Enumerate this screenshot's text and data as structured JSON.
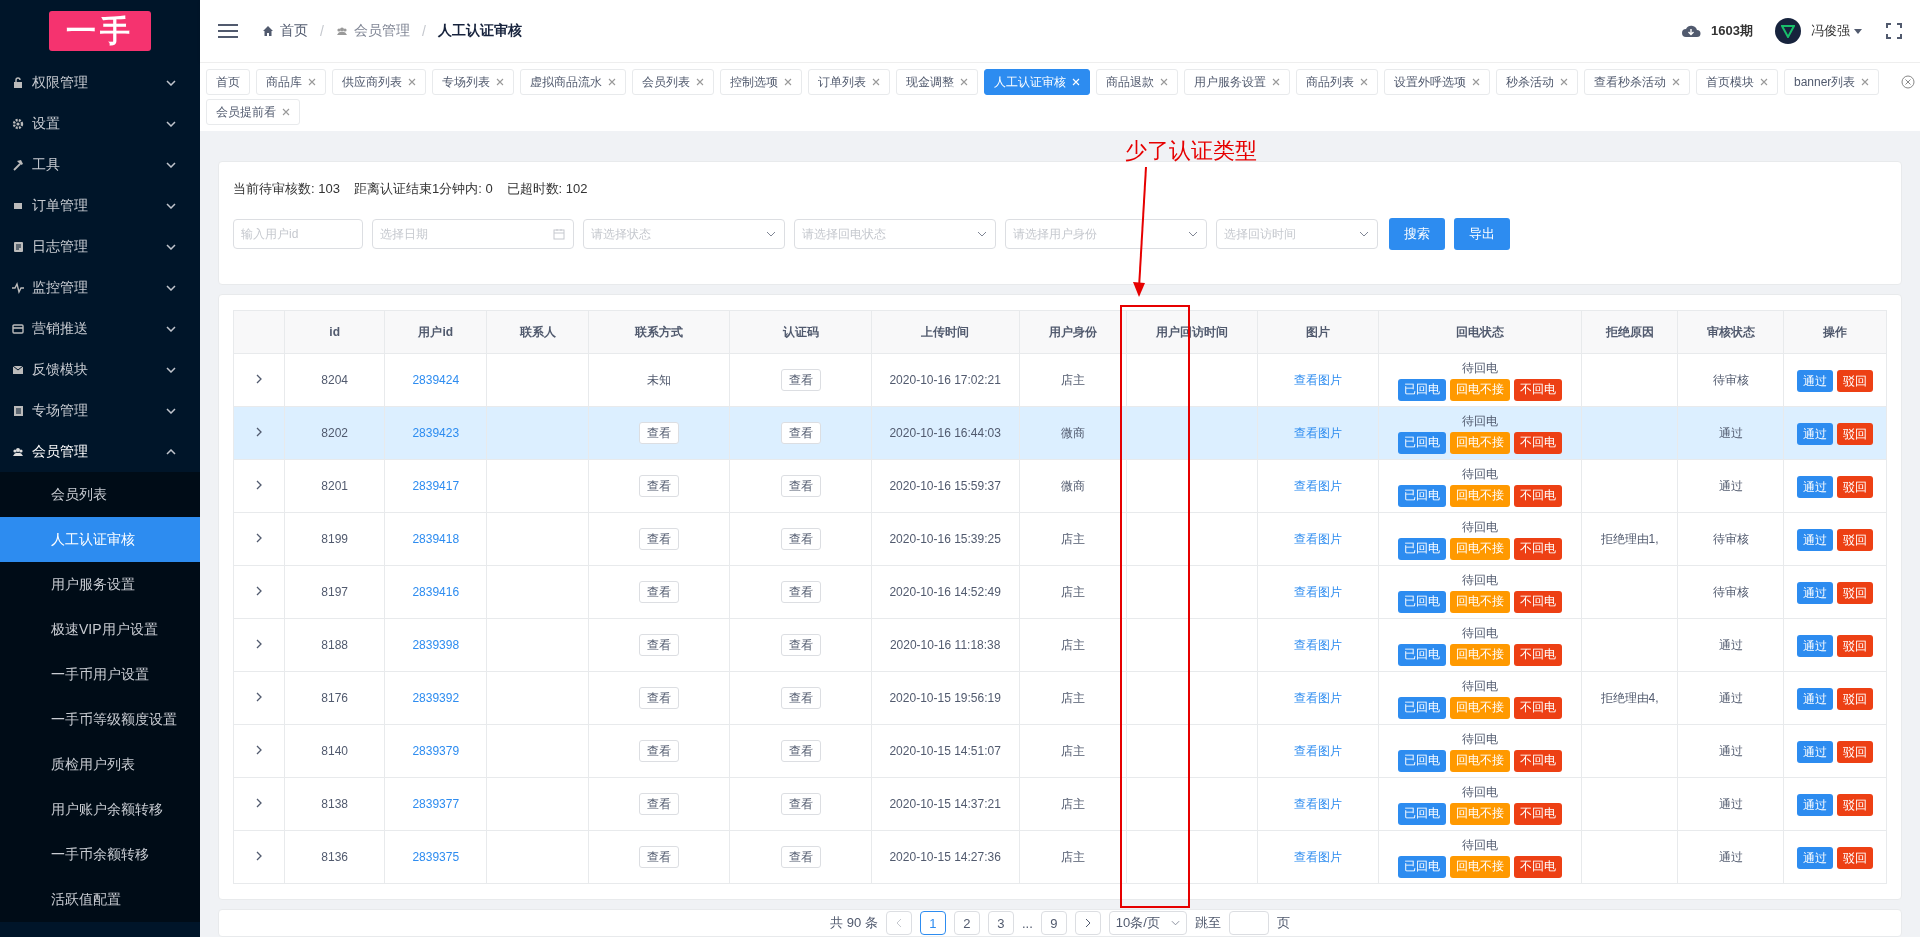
{
  "logo": {
    "text": "一手"
  },
  "sidebar": {
    "items": [
      {
        "label": "权限管理",
        "expanded": false
      },
      {
        "label": "设置",
        "expanded": false
      },
      {
        "label": "工具",
        "expanded": false
      },
      {
        "label": "订单管理",
        "expanded": false
      },
      {
        "label": "日志管理",
        "expanded": false
      },
      {
        "label": "监控管理",
        "expanded": false
      },
      {
        "label": "营销推送",
        "expanded": false
      },
      {
        "label": "反馈模块",
        "expanded": false
      },
      {
        "label": "专场管理",
        "expanded": false
      },
      {
        "label": "会员管理",
        "expanded": true,
        "children": [
          {
            "label": "会员列表",
            "selected": false
          },
          {
            "label": "人工认证审核",
            "selected": true
          },
          {
            "label": "用户服务设置",
            "selected": false
          },
          {
            "label": "极速VIP用户设置",
            "selected": false
          },
          {
            "label": "一手币用户设置",
            "selected": false
          },
          {
            "label": "一手币等级额度设置",
            "selected": false
          },
          {
            "label": "质检用户列表",
            "selected": false
          },
          {
            "label": "用户账户余额转移",
            "selected": false
          },
          {
            "label": "一手币余额转移",
            "selected": false
          },
          {
            "label": "活跃值配置",
            "selected": false
          }
        ]
      }
    ]
  },
  "breadcrumb_separator": "/",
  "breadcrumb": [
    {
      "label": "首页"
    },
    {
      "label": "会员管理"
    },
    {
      "label": "人工认证审核"
    }
  ],
  "header": {
    "period": "1603期",
    "user": "冯俊强"
  },
  "tabs": [
    {
      "label": "首页",
      "closable": false,
      "selected": false
    },
    {
      "label": "商品库",
      "closable": true,
      "selected": false
    },
    {
      "label": "供应商列表",
      "closable": true,
      "selected": false
    },
    {
      "label": "专场列表",
      "closable": true,
      "selected": false
    },
    {
      "label": "虚拟商品流水",
      "closable": true,
      "selected": false
    },
    {
      "label": "会员列表",
      "closable": true,
      "selected": false
    },
    {
      "label": "控制选项",
      "closable": true,
      "selected": false
    },
    {
      "label": "订单列表",
      "closable": true,
      "selected": false
    },
    {
      "label": "现金调整",
      "closable": true,
      "selected": false
    },
    {
      "label": "人工认证审核",
      "closable": true,
      "selected": true
    },
    {
      "label": "商品退款",
      "closable": true,
      "selected": false
    },
    {
      "label": "用户服务设置",
      "closable": true,
      "selected": false
    },
    {
      "label": "商品列表",
      "closable": true,
      "selected": false
    },
    {
      "label": "设置外呼选项",
      "closable": true,
      "selected": false
    },
    {
      "label": "秒杀活动",
      "closable": true,
      "selected": false
    },
    {
      "label": "查看秒杀活动",
      "closable": true,
      "selected": false
    },
    {
      "label": "首页模块",
      "closable": true,
      "selected": false
    },
    {
      "label": "banner列表",
      "closable": true,
      "selected": false
    },
    {
      "label": "会员提前看",
      "closable": true,
      "selected": false
    }
  ],
  "stats": [
    "当前待审核数: 103",
    "距离认证结束1分钟内: 0",
    "已超时数: 102"
  ],
  "filters": [
    {
      "kind": "input",
      "placeholder": "输入用户id"
    },
    {
      "kind": "date",
      "placeholder": "选择日期"
    },
    {
      "kind": "select",
      "placeholder": "请选择状态"
    },
    {
      "kind": "select",
      "placeholder": "请选择回电状态"
    },
    {
      "kind": "select",
      "placeholder": "请选择用户身份"
    },
    {
      "kind": "select",
      "placeholder": "选择回访时间"
    }
  ],
  "filter_buttons": [
    "搜索",
    "导出"
  ],
  "table": {
    "columns": [
      "id",
      "用户id",
      "联系人",
      "联系方式",
      "认证码",
      "上传时间",
      "用户身份",
      "用户回访时间",
      "图片",
      "回电状态",
      "拒绝原因",
      "审核状态",
      "操作"
    ],
    "rows": [
      {
        "id": "8204",
        "user_id": "2839424",
        "contact": {
          "kind": "text",
          "label": "未知"
        },
        "code": "查看",
        "upload_time": "2020-10-16 17:02:21",
        "identity": "店主",
        "image": "查看图片",
        "callback_status": "待回电",
        "callback_buttons": [
          {
            "label": "已回电",
            "kind": "primary"
          },
          {
            "label": "回电不接",
            "kind": "warning"
          },
          {
            "label": "不回电",
            "kind": "danger"
          }
        ],
        "review_status": "待审核",
        "actions": [
          {
            "label": "通过",
            "kind": "primary"
          },
          {
            "label": "驳回",
            "kind": "danger"
          }
        ],
        "selected": false
      },
      {
        "id": "8202",
        "user_id": "2839423",
        "contact": {
          "kind": "button",
          "label": "查看"
        },
        "code": "查看",
        "upload_time": "2020-10-16 16:44:03",
        "identity": "微商",
        "image": "查看图片",
        "callback_status": "待回电",
        "callback_buttons": [
          {
            "label": "已回电",
            "kind": "primary"
          },
          {
            "label": "回电不接",
            "kind": "warning"
          },
          {
            "label": "不回电",
            "kind": "danger"
          }
        ],
        "review_status": "通过",
        "actions": [
          {
            "label": "通过",
            "kind": "primary"
          },
          {
            "label": "驳回",
            "kind": "danger"
          }
        ],
        "selected": true
      },
      {
        "id": "8201",
        "user_id": "2839417",
        "contact": {
          "kind": "button",
          "label": "查看"
        },
        "code": "查看",
        "upload_time": "2020-10-16 15:59:37",
        "identity": "微商",
        "image": "查看图片",
        "callback_status": "待回电",
        "callback_buttons": [
          {
            "label": "已回电",
            "kind": "primary"
          },
          {
            "label": "回电不接",
            "kind": "warning"
          },
          {
            "label": "不回电",
            "kind": "danger"
          }
        ],
        "review_status": "通过",
        "actions": [
          {
            "label": "通过",
            "kind": "primary"
          },
          {
            "label": "驳回",
            "kind": "danger"
          }
        ],
        "selected": false
      },
      {
        "id": "8199",
        "user_id": "2839418",
        "contact": {
          "kind": "button",
          "label": "查看"
        },
        "code": "查看",
        "upload_time": "2020-10-16 15:39:25",
        "identity": "店主",
        "image": "查看图片",
        "callback_status": "待回电",
        "callback_buttons": [
          {
            "label": "已回电",
            "kind": "primary"
          },
          {
            "label": "回电不接",
            "kind": "warning"
          },
          {
            "label": "不回电",
            "kind": "danger"
          }
        ],
        "reject_reason": "拒绝理由1,",
        "review_status": "待审核",
        "actions": [
          {
            "label": "通过",
            "kind": "primary"
          },
          {
            "label": "驳回",
            "kind": "danger"
          }
        ],
        "selected": false
      },
      {
        "id": "8197",
        "user_id": "2839416",
        "contact": {
          "kind": "button",
          "label": "查看"
        },
        "code": "查看",
        "upload_time": "2020-10-16 14:52:49",
        "identity": "店主",
        "image": "查看图片",
        "callback_status": "待回电",
        "callback_buttons": [
          {
            "label": "已回电",
            "kind": "primary"
          },
          {
            "label": "回电不接",
            "kind": "warning"
          },
          {
            "label": "不回电",
            "kind": "danger"
          }
        ],
        "review_status": "待审核",
        "actions": [
          {
            "label": "通过",
            "kind": "primary"
          },
          {
            "label": "驳回",
            "kind": "danger"
          }
        ],
        "selected": false
      },
      {
        "id": "8188",
        "user_id": "2839398",
        "contact": {
          "kind": "button",
          "label": "查看"
        },
        "code": "查看",
        "upload_time": "2020-10-16 11:18:38",
        "identity": "店主",
        "image": "查看图片",
        "callback_status": "待回电",
        "callback_buttons": [
          {
            "label": "已回电",
            "kind": "primary"
          },
          {
            "label": "回电不接",
            "kind": "warning"
          },
          {
            "label": "不回电",
            "kind": "danger"
          }
        ],
        "review_status": "通过",
        "actions": [
          {
            "label": "通过",
            "kind": "primary"
          },
          {
            "label": "驳回",
            "kind": "danger"
          }
        ],
        "selected": false
      },
      {
        "id": "8176",
        "user_id": "2839392",
        "contact": {
          "kind": "button",
          "label": "查看"
        },
        "code": "查看",
        "upload_time": "2020-10-15 19:56:19",
        "identity": "店主",
        "image": "查看图片",
        "callback_status": "待回电",
        "callback_buttons": [
          {
            "label": "已回电",
            "kind": "primary"
          },
          {
            "label": "回电不接",
            "kind": "warning"
          },
          {
            "label": "不回电",
            "kind": "danger"
          }
        ],
        "reject_reason": "拒绝理由4,",
        "review_status": "通过",
        "actions": [
          {
            "label": "通过",
            "kind": "primary"
          },
          {
            "label": "驳回",
            "kind": "danger"
          }
        ],
        "selected": false
      },
      {
        "id": "8140",
        "user_id": "2839379",
        "contact": {
          "kind": "button",
          "label": "查看"
        },
        "code": "查看",
        "upload_time": "2020-10-15 14:51:07",
        "identity": "店主",
        "image": "查看图片",
        "callback_status": "待回电",
        "callback_buttons": [
          {
            "label": "已回电",
            "kind": "primary"
          },
          {
            "label": "回电不接",
            "kind": "warning"
          },
          {
            "label": "不回电",
            "kind": "danger"
          }
        ],
        "review_status": "通过",
        "actions": [
          {
            "label": "通过",
            "kind": "primary"
          },
          {
            "label": "驳回",
            "kind": "danger"
          }
        ],
        "selected": false
      },
      {
        "id": "8138",
        "user_id": "2839377",
        "contact": {
          "kind": "button",
          "label": "查看"
        },
        "code": "查看",
        "upload_time": "2020-10-15 14:37:21",
        "identity": "店主",
        "image": "查看图片",
        "callback_status": "待回电",
        "callback_buttons": [
          {
            "label": "已回电",
            "kind": "primary"
          },
          {
            "label": "回电不接",
            "kind": "warning"
          },
          {
            "label": "不回电",
            "kind": "danger"
          }
        ],
        "review_status": "通过",
        "actions": [
          {
            "label": "通过",
            "kind": "primary"
          },
          {
            "label": "驳回",
            "kind": "danger"
          }
        ],
        "selected": false
      },
      {
        "id": "8136",
        "user_id": "2839375",
        "contact": {
          "kind": "button",
          "label": "查看"
        },
        "code": "查看",
        "upload_time": "2020-10-15 14:27:36",
        "identity": "店主",
        "image": "查看图片",
        "callback_status": "待回电",
        "callback_buttons": [
          {
            "label": "已回电",
            "kind": "primary"
          },
          {
            "label": "回电不接",
            "kind": "warning"
          },
          {
            "label": "不回电",
            "kind": "danger"
          }
        ],
        "review_status": "通过",
        "actions": [
          {
            "label": "通过",
            "kind": "primary"
          },
          {
            "label": "驳回",
            "kind": "danger"
          }
        ],
        "selected": false
      }
    ]
  },
  "pagination": {
    "total": "共 90 条",
    "pages": [
      {
        "label": "1",
        "selected": true
      },
      {
        "label": "2",
        "selected": false
      },
      {
        "label": "3",
        "selected": false
      },
      {
        "label": "9",
        "selected": false
      }
    ],
    "ellipsis": "...",
    "page_size": "10条/页",
    "jump_label": "跳至",
    "jump_suffix": "页"
  },
  "annotation": {
    "text": "少了认证类型"
  }
}
